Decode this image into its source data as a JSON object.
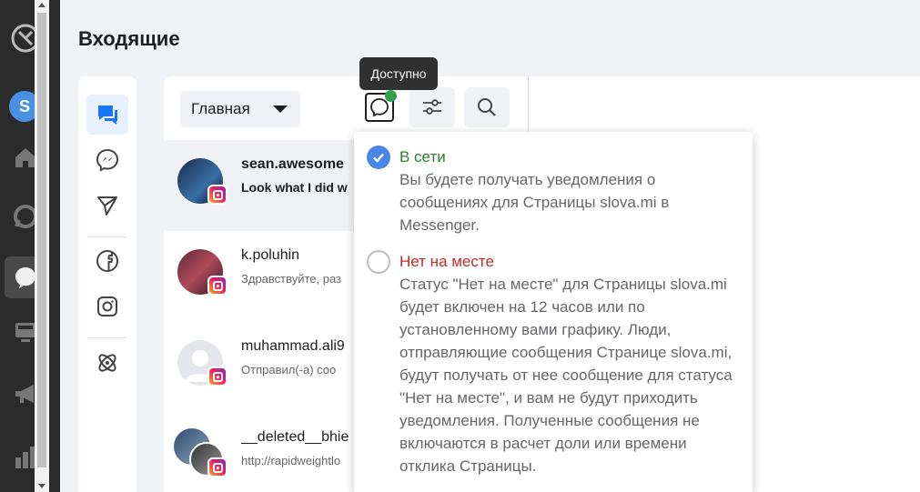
{
  "page": {
    "title": "Входящие"
  },
  "rail": {
    "avatar_letter": "S"
  },
  "toolbar": {
    "filter_value": "Главная",
    "status_tooltip": "Доступно"
  },
  "conversations": [
    {
      "name": "sean.awesome",
      "snippet": "Look what I did w",
      "unread": true
    },
    {
      "name": "k.poluhin",
      "snippet": "Здравствуйте, раз",
      "unread": false
    },
    {
      "name": "muhammad.ali9",
      "snippet": "Отправил(-а) соо",
      "unread": false
    },
    {
      "name": "__deleted__bhie",
      "snippet": "http://rapidweightlo",
      "unread": false
    }
  ],
  "status_menu": {
    "online": {
      "title": "В сети",
      "description": "Вы будете получать уведомления о сообщениях для Страницы slova.mi в Messenger.",
      "selected": true
    },
    "away": {
      "title": "Нет на месте",
      "description": "Статус \"Нет на месте\" для Страницы slova.mi будет включен на 12 часов или по установленному вами графику. Люди, отправляющие сообщения Странице slova.mi, будут получать от нее сообщение для статуса \"Нет на месте\", и вам не будут приходить уведомления. Полученные сообщения не включаются в расчет доли или времени отклика Страницы.",
      "selected": false
    }
  },
  "colors": {
    "accent": "#1877f2",
    "online": "#31a24c",
    "away": "#c62828",
    "radio_checked": "#4a86e8"
  }
}
